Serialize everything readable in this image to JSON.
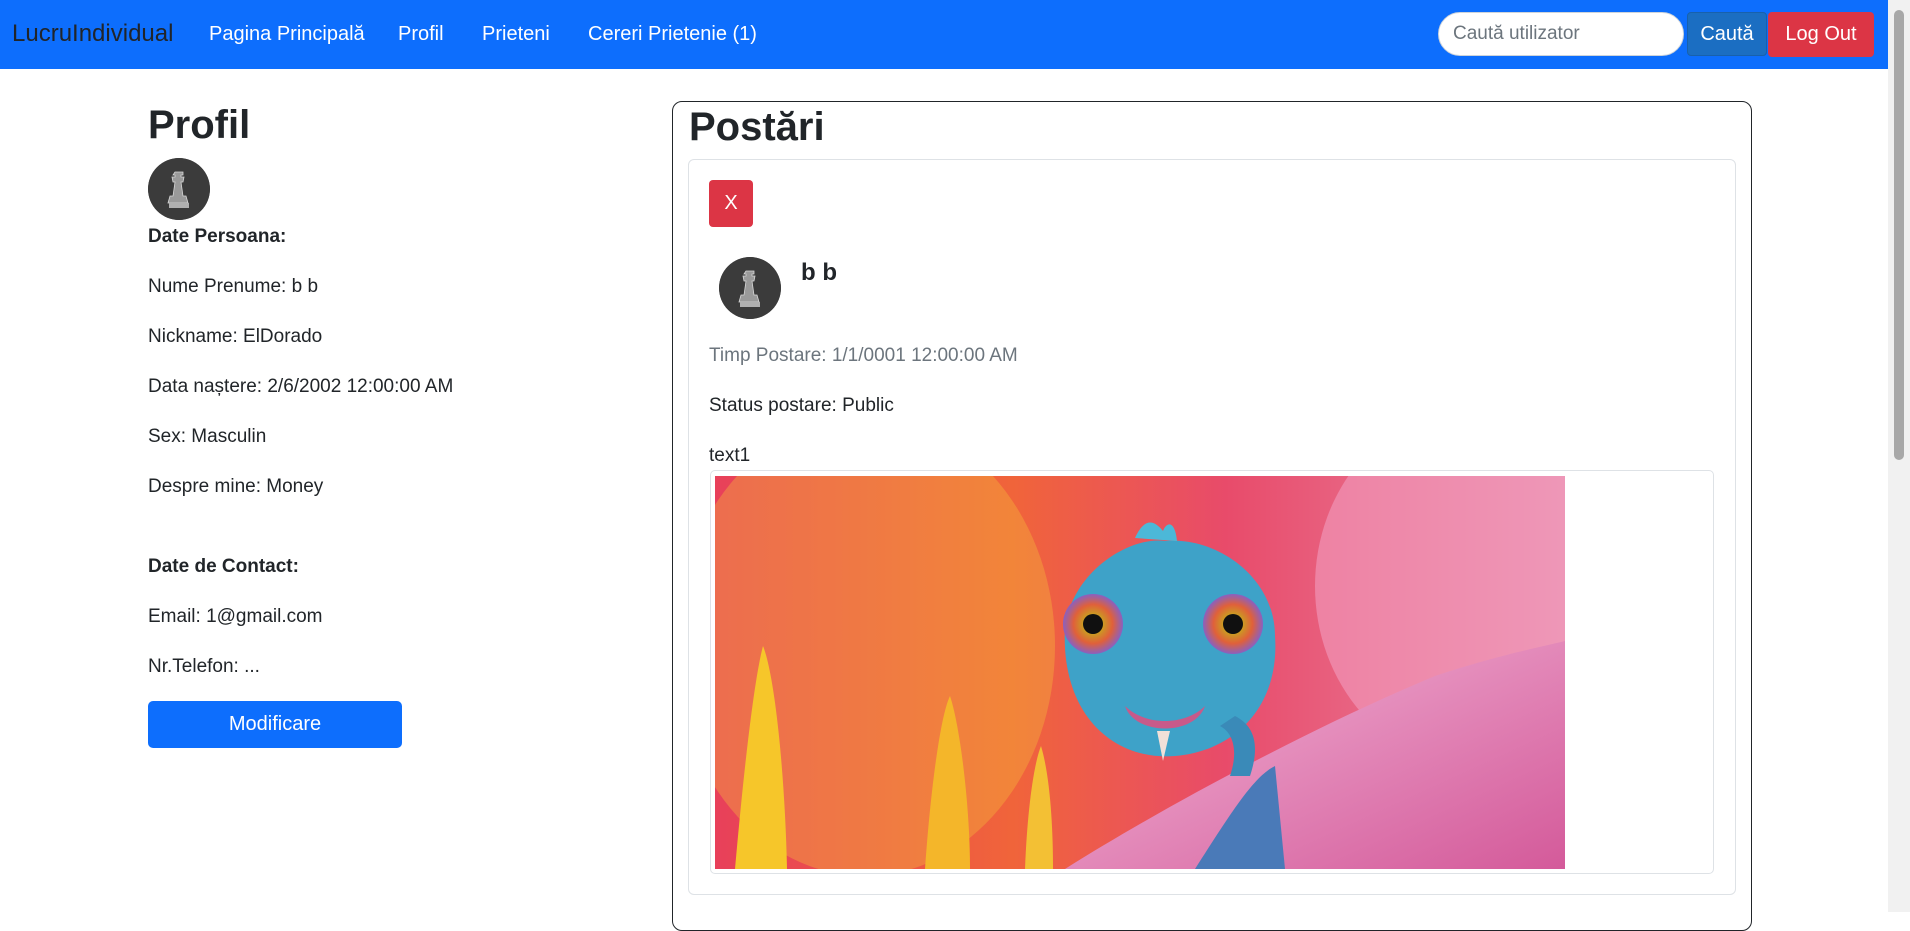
{
  "navbar": {
    "brand": "LucruIndividual",
    "links": [
      "Pagina Principală",
      "Profil",
      "Prieteni",
      "Cereri Prietenie (1)"
    ],
    "search_placeholder": "Caută utilizator",
    "search_button": "Caută",
    "logout_button": "Log Out",
    "colors": {
      "background": "#0d6efd",
      "logout": "#dc3545"
    }
  },
  "profile": {
    "title": "Profil",
    "avatar_icon": "chess-piece-avatar",
    "personal_heading": "Date Persoana:",
    "name": "Nume Prenume: b b",
    "nickname": "Nickname: ElDorado",
    "birthdate": "Data naștere: 2/6/2002 12:00:00 AM",
    "sex": "Sex: Masculin",
    "about": "Despre mine: Money",
    "contact_heading": "Date de Contact:",
    "email": "Email: 1@gmail.com",
    "phone": "Nr.Telefon: ...",
    "modify_button": "Modificare"
  },
  "posts": {
    "title": "Postări",
    "items": [
      {
        "delete_label": "X",
        "author": "b b",
        "avatar_icon": "chess-piece-avatar",
        "time": "Timp Postare: 1/1/0001 12:00:00 AM",
        "status": "Status postare: Public",
        "text": "text1",
        "image_icon": "chameleon-photo"
      }
    ]
  }
}
